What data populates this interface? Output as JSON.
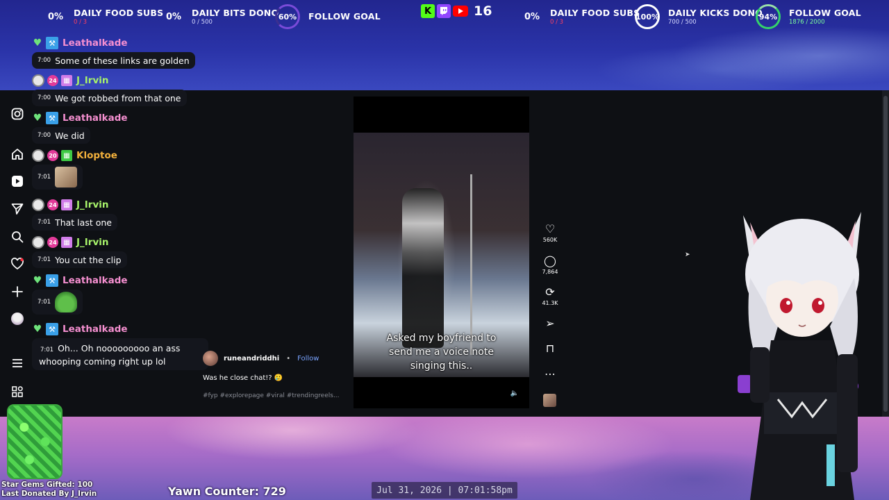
{
  "goals_left": [
    {
      "percent": "0%",
      "title": "DAILY FOOD SUBS",
      "sub": "0 / 3",
      "sub_red": true
    },
    {
      "percent": "0%",
      "title": "DAILY BITS DONO",
      "sub": "0 / 500",
      "sub_red": false
    },
    {
      "percent": "60%",
      "title": "FOLLOW GOAL",
      "sub": "",
      "sub_red": false
    }
  ],
  "goals_right": [
    {
      "percent": "0%",
      "title": "DAILY FOOD SUBS",
      "sub": "0 / 3",
      "sub_red": true
    },
    {
      "percent": "100%",
      "title": "DAILY KICKS DONO",
      "sub": "700 / 500",
      "sub_red": false
    },
    {
      "percent": "94%",
      "title": "FOLLOW GOAL",
      "sub": "1876 / 2000",
      "sub_red": false
    }
  ],
  "platforms": {
    "kick_icon": "K",
    "twitch_icon": "twitch-icon",
    "youtube_icon": "youtube-icon",
    "count": "16"
  },
  "chat": [
    {
      "user": "Leathalkade",
      "color": "#f58fd0",
      "time": "7:00",
      "text": "Some of these links are golden"
    },
    {
      "user": "J_Irvin",
      "color": "#a7f26a",
      "sub_months": "24",
      "time": "7:00",
      "text": "We got robbed from that one"
    },
    {
      "user": "Leathalkade",
      "color": "#f58fd0",
      "time": "7:00",
      "text": "We did"
    },
    {
      "user": "Kloptoe",
      "color": "#f3b13c",
      "sub_months": "20",
      "time": "7:01",
      "text": ""
    },
    {
      "user": "J_Irvin",
      "color": "#a7f26a",
      "sub_months": "24",
      "time": "7:01",
      "text": "That last one"
    },
    {
      "user": "J_Irvin",
      "color": "#a7f26a",
      "sub_months": "24",
      "time": "7:01",
      "text": "You cut the clip"
    },
    {
      "user": "Leathalkade",
      "color": "#f58fd0",
      "time": "7:01",
      "text": ""
    },
    {
      "user": "Leathalkade",
      "color": "#f58fd0",
      "time": "7:01",
      "text": "Oh... Oh nooooooooo an ass whooping coming right up lol"
    }
  ],
  "nav_icons": [
    "instagram-icon",
    "home-icon",
    "reels-icon",
    "send-icon",
    "search-icon",
    "heart-icon",
    "plus-icon",
    "profile-icon",
    "menu-icon",
    "apps-icon"
  ],
  "post": {
    "author": "runeandriddhi",
    "separator": "•",
    "follow": "Follow",
    "caption": "Was he close chat!? 🥲",
    "tags": "#fyp #explorepage #viral #trendingreels...",
    "video_caption": "Asked my boyfriend to send me a voice note singing this..",
    "mute_icon": "🔈"
  },
  "actions": [
    {
      "icon": "♡",
      "name": "like",
      "count": "560K"
    },
    {
      "icon": "◯",
      "name": "comment",
      "count": "7,864"
    },
    {
      "icon": "⟳",
      "name": "repost",
      "count": "41.3K"
    },
    {
      "icon": "➢",
      "name": "share",
      "count": ""
    },
    {
      "icon": "⊓",
      "name": "save",
      "count": ""
    },
    {
      "icon": "⋯",
      "name": "more",
      "count": ""
    }
  ],
  "bottom": {
    "gems_gifted": "Star Gems Gifted: 100",
    "last_donated": "Last Donated By J_Irvin",
    "yawn_counter": "Yawn Counter: 729",
    "clock": "Jul 31, 2026 | 07:01:58pm"
  },
  "colors": {
    "ring_purple": "#7a4bd8",
    "ring_white": "#ffffff",
    "ring_green": "#35d36a",
    "kick_green": "#53fc18",
    "twitch_purple": "#9146ff",
    "youtube_red": "#ff0000"
  }
}
